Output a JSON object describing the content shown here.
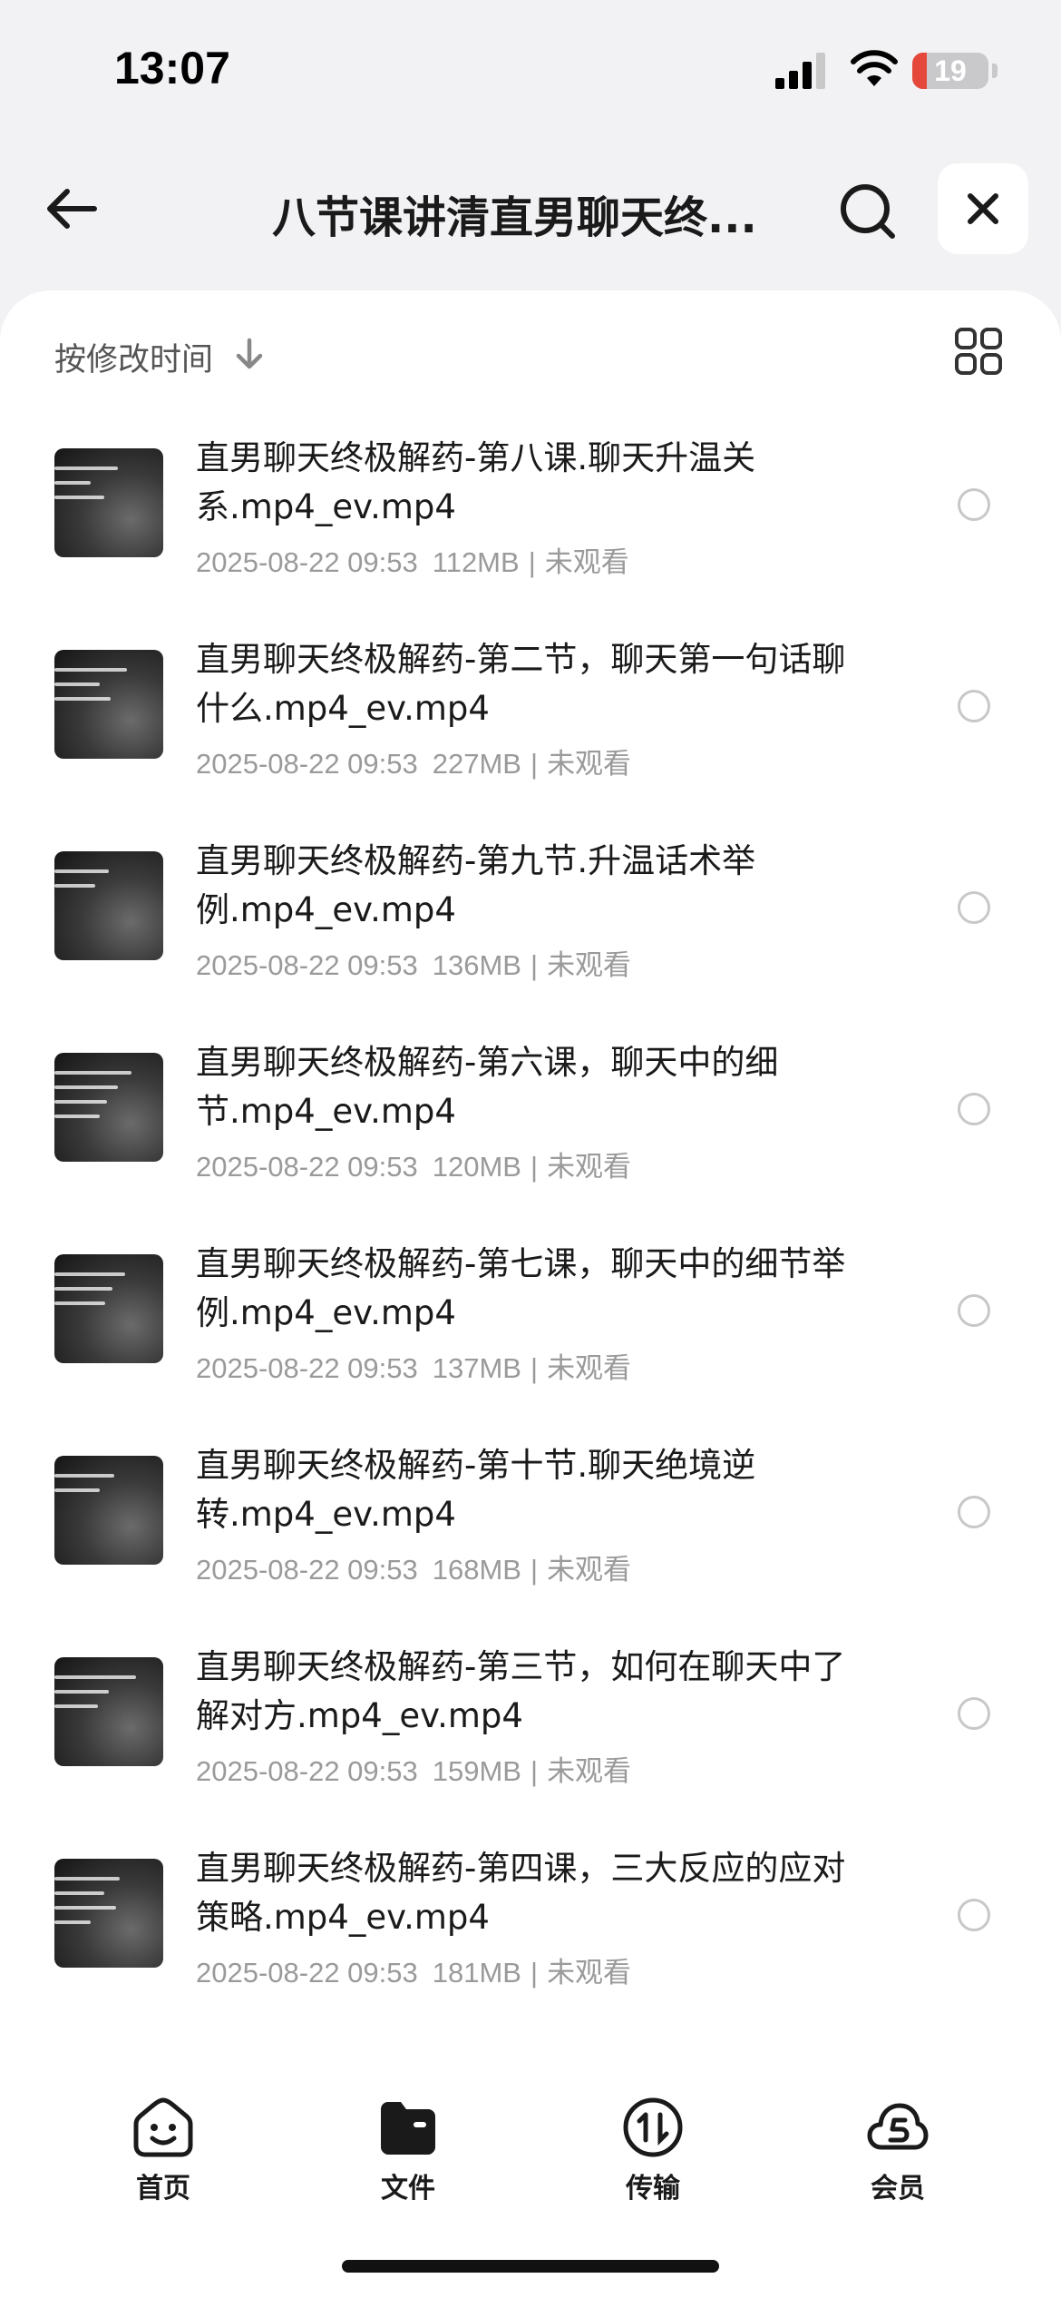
{
  "status_bar": {
    "time": "13:07",
    "battery_level": "19",
    "battery_fraction": 0.19,
    "battery_color": "#e5483b"
  },
  "header": {
    "title": "八节课讲清直男聊天终...",
    "back_icon": "arrow-left-icon",
    "search_icon": "search-icon",
    "close_icon": "close-icon"
  },
  "sort_bar": {
    "label": "按修改时间",
    "arrow_icon": "arrow-down-icon",
    "view_icon": "grid-view-icon"
  },
  "files": [
    {
      "name": "直男聊天终极解药-第八课.聊天升温关系.mp4_ev.mp4",
      "date": "2025-08-22 09:53",
      "size": "112MB",
      "status": "未观看"
    },
    {
      "name": "直男聊天终极解药-第二节，聊天第一句话聊什么.mp4_ev.mp4",
      "date": "2025-08-22 09:53",
      "size": "227MB",
      "status": "未观看"
    },
    {
      "name": "直男聊天终极解药-第九节.升温话术举例.mp4_ev.mp4",
      "date": "2025-08-22 09:53",
      "size": "136MB",
      "status": "未观看"
    },
    {
      "name": "直男聊天终极解药-第六课，聊天中的细节.mp4_ev.mp4",
      "date": "2025-08-22 09:53",
      "size": "120MB",
      "status": "未观看"
    },
    {
      "name": "直男聊天终极解药-第七课，聊天中的细节举例.mp4_ev.mp4",
      "date": "2025-08-22 09:53",
      "size": "137MB",
      "status": "未观看"
    },
    {
      "name": "直男聊天终极解药-第十节.聊天绝境逆转.mp4_ev.mp4",
      "date": "2025-08-22 09:53",
      "size": "168MB",
      "status": "未观看"
    },
    {
      "name": "直男聊天终极解药-第三节，如何在聊天中了解对方.mp4_ev.mp4",
      "date": "2025-08-22 09:53",
      "size": "159MB",
      "status": "未观看"
    },
    {
      "name": "直男聊天终极解药-第四课，三大反应的应对策略.mp4_ev.mp4",
      "date": "2025-08-22 09:53",
      "size": "181MB",
      "status": "未观看"
    }
  ],
  "tab_bar": {
    "tabs": [
      {
        "label": "首页",
        "icon": "home-face-icon"
      },
      {
        "label": "文件",
        "icon": "folder-icon"
      },
      {
        "label": "传输",
        "icon": "transfer-icon"
      },
      {
        "label": "会员",
        "icon": "vip-cloud-icon"
      }
    ]
  }
}
